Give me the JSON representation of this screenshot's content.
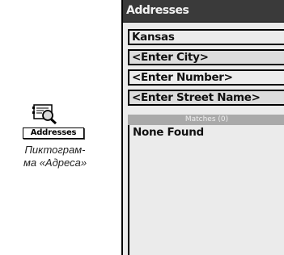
{
  "icon": {
    "name": "addresses-icon",
    "label": "Addresses"
  },
  "caption": {
    "line1": "Пиктограм-",
    "line2": "ма «Адреса»"
  },
  "screen": {
    "title": "Addresses",
    "fields": {
      "state": "Kansas",
      "city": "<Enter City>",
      "number": "<Enter Number>",
      "street": "<Enter Street Name>"
    },
    "matches_label": "Matches (0)",
    "results": [
      "None Found"
    ]
  }
}
